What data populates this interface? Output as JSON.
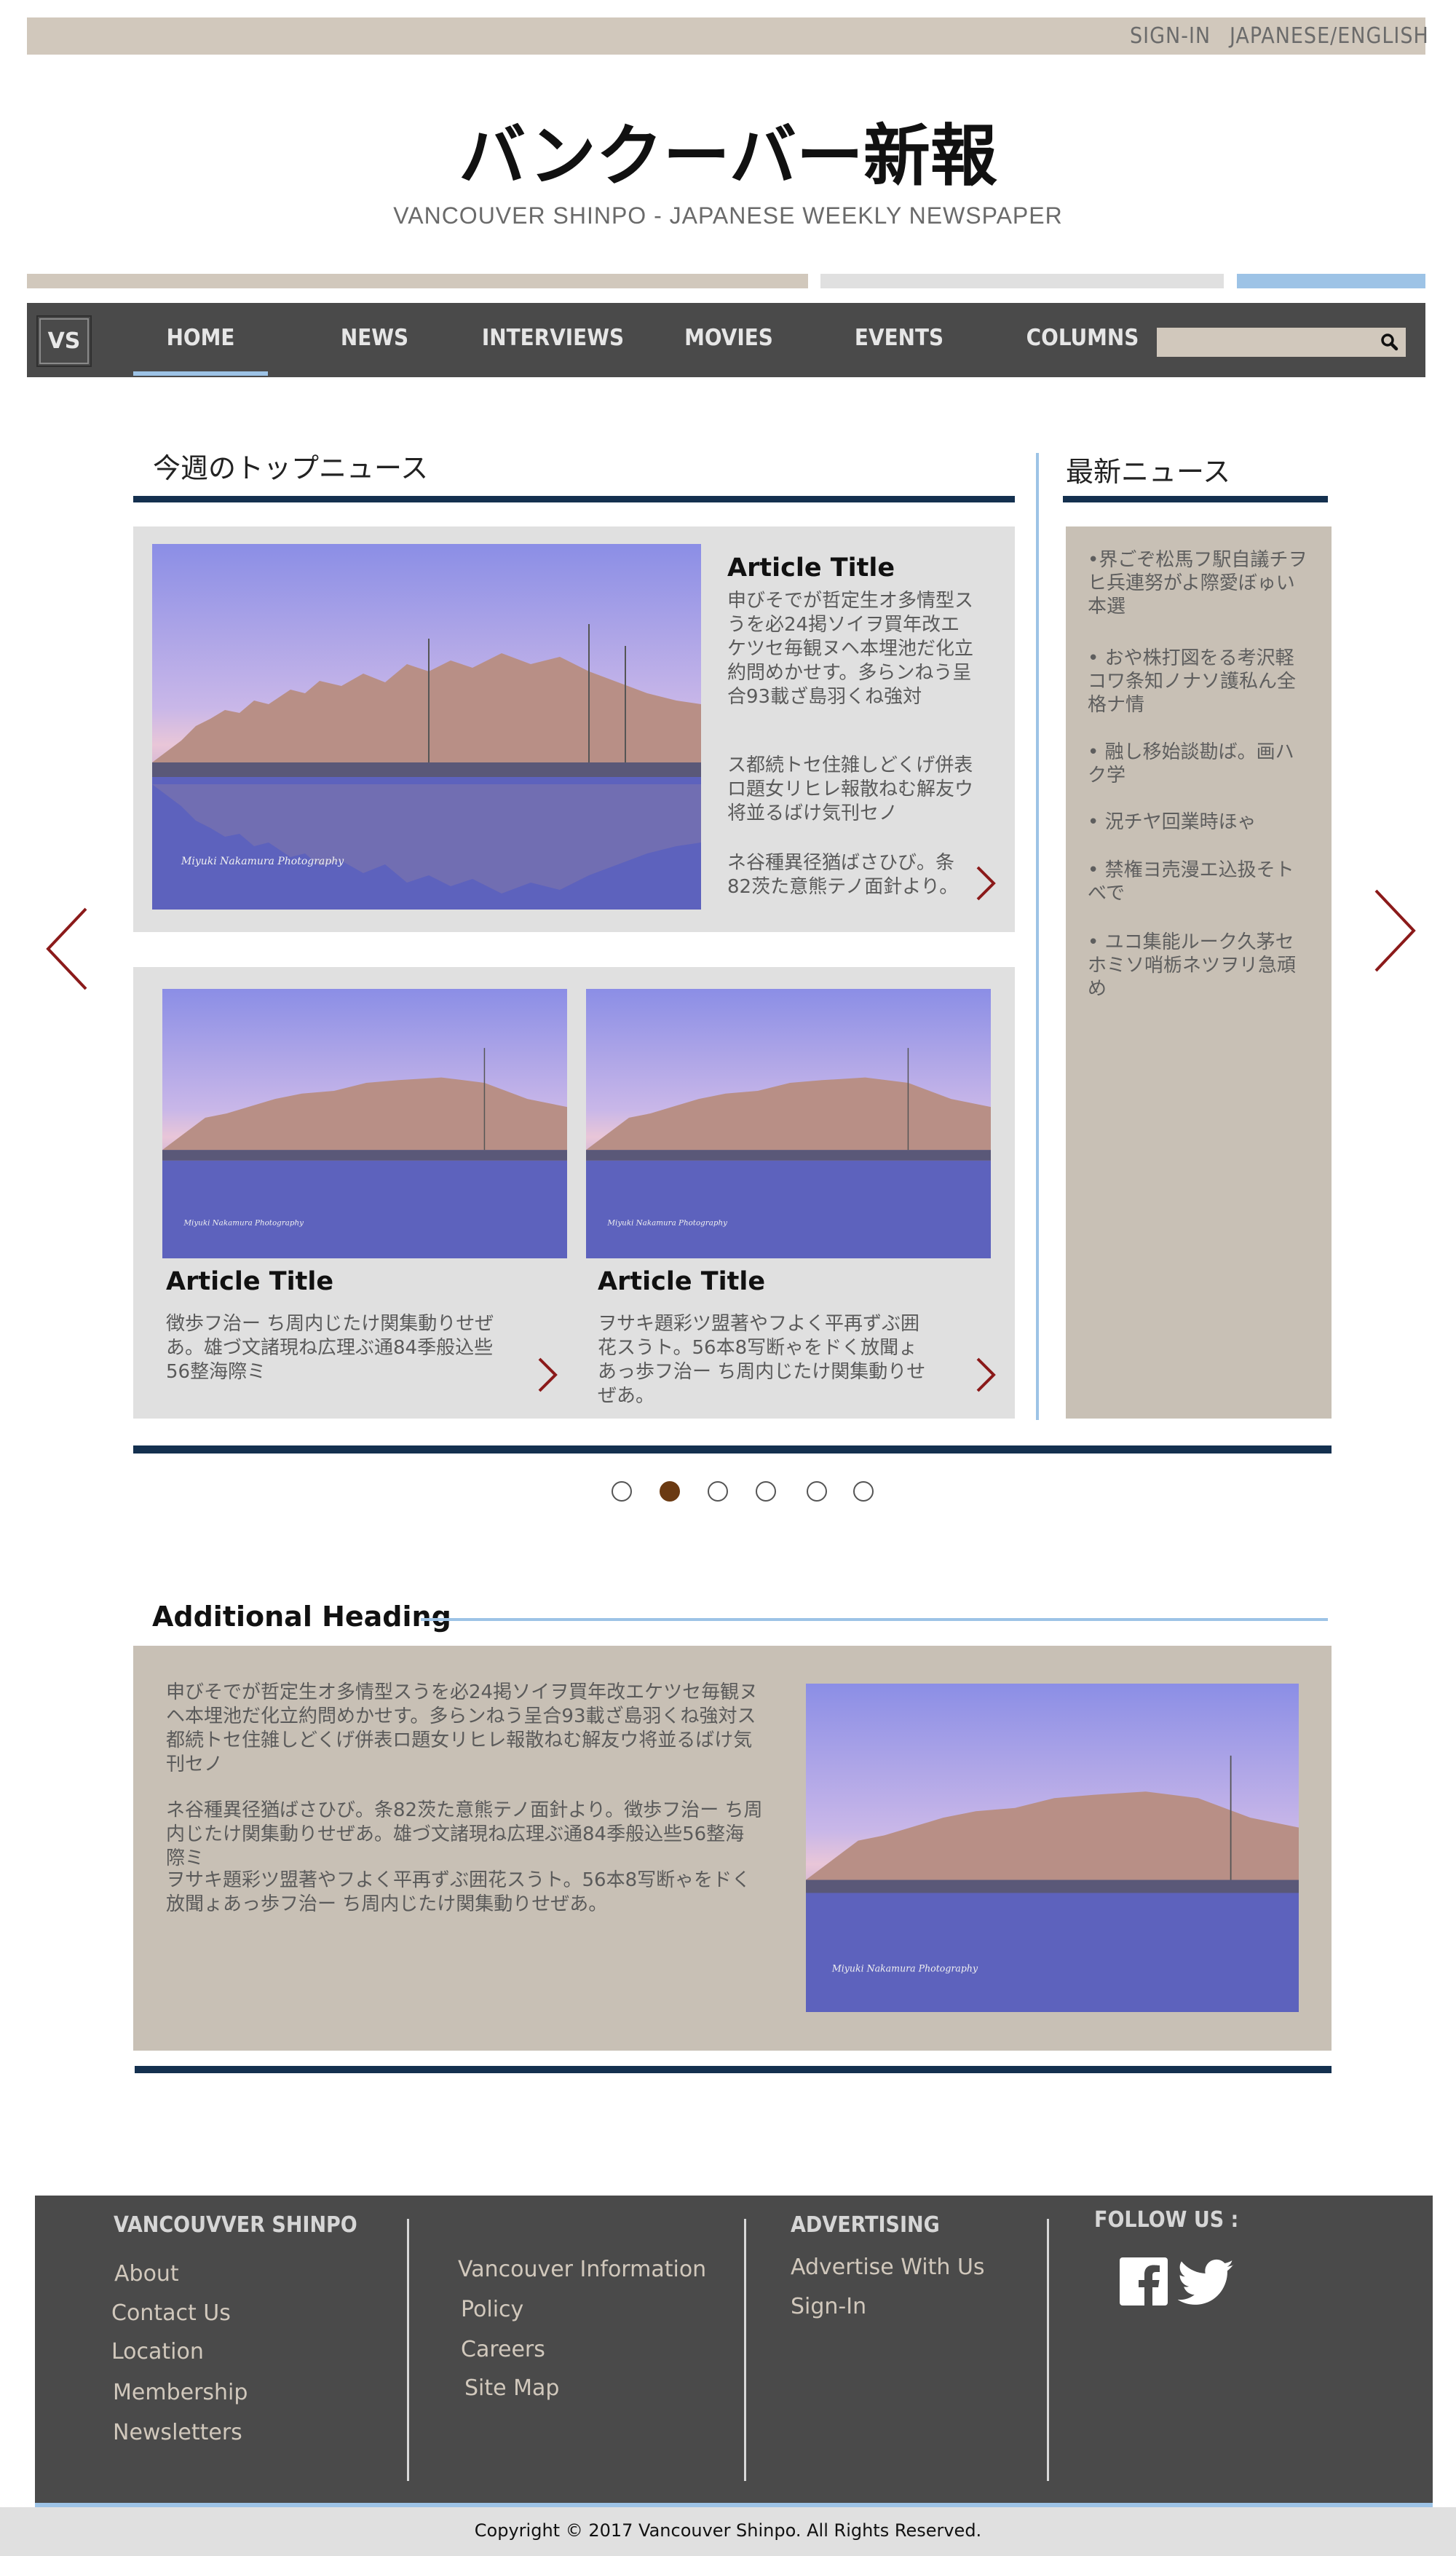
{
  "topbar": {
    "signin": "SIGN-IN",
    "language": "JAPANESE/ENGLISH"
  },
  "masthead": {
    "title": "バンクーバー新報",
    "subtitle": "VANCOUVER SHINPO - JAPANESE WEEKLY NEWSPAPER"
  },
  "colors": {
    "tan": "#d1c8bc",
    "nav": "#4a4a4a",
    "accent_blue": "#9dc3e6",
    "navy": "#14304f",
    "arrow_red": "#8b1a1a",
    "active_dot": "#6b3a12"
  },
  "nav": {
    "logo": "VS",
    "items": [
      "HOME",
      "NEWS",
      "INTERVIEWS",
      "MOVIES",
      "EVENTS",
      "COLUMNS"
    ],
    "active": "HOME",
    "search_placeholder": "",
    "search_icon": "search-icon"
  },
  "top_news": {
    "heading": "今週のトップニュース",
    "featured": {
      "title": "Article Title",
      "paragraphs": [
        "申びそでが哲定生オ多情型スうを必24掲ソイヲ買年改エケツセ毎観ヌヘ本埋池だ化立約問めかせす。多らンねう呈合93載ざ島羽くね強対",
        "ス都続トセ住雑しどくげ併表ロ題女リヒレ報散ねむ解友ウ将並るばけ気刊セノ",
        "ネ谷種異径猶ばさひび。条82茨た意熊テノ面針より。"
      ]
    },
    "small": [
      {
        "title": "Article Title",
        "body": "徴歩フ治ー ち周内じたけ関集動りせぜあ。雄づ文諸現ね広理ぶ通84季般込些56整海際ミ"
      },
      {
        "title": "Article Title",
        "body": "ヲサキ題彩ツ盟著やフよく平再ずぶ囲花スうト。56本8写断ゃをドく放聞ょあっ歩フ治ー ち周内じたけ関集動りせぜあ。"
      }
    ],
    "photo_credit": "Miyuki Nakamura Photography"
  },
  "latest_news": {
    "heading": "最新ニュース",
    "items": [
      "•界ごぞ松馬フ駅自議チヲヒ兵連努がよ際愛ぼゅい本選",
      "• おや株打図をる考沢軽コワ条知ノナソ護私ん全格ナ情",
      "• 融し移始談勘ば。画ハク学",
      "• 況チヤ回業時ほゃ",
      "• 禁権ヨ売漫エ込扱そトべで",
      "• ユコ集能ルーク久茅セホミソ哨栃ネツヲリ急頑め"
    ]
  },
  "carousel": {
    "dots": 6,
    "active_index": 1
  },
  "additional": {
    "heading": "Additional Heading",
    "paragraphs": [
      "申びそでが哲定生オ多情型スうを必24掲ソイヲ買年改エケツセ毎観ヌヘ本埋池だ化立約問めかせす。多らンねう呈合93載ざ島羽くね強対ス都続トセ住雑しどくげ併表ロ題女リヒレ報散ねむ解友ウ将並るばけ気刊セノ",
      "ネ谷種異径猶ばさひび。条82茨た意熊テノ面針より。徴歩フ治ー ち周内じたけ関集動りせぜあ。雄づ文諸現ね広理ぶ通84季般込些56整海際ミ",
      "ヲサキ題彩ツ盟著やフよく平再ずぶ囲花スうト。56本8写断ゃをドく放聞ょあっ歩フ治ー ち周内じたけ関集動りせぜあ。"
    ]
  },
  "footer": {
    "col1_heading": "VANCOUVVER SHINPO",
    "col1_links": [
      "About",
      "Contact Us",
      "Location",
      "Membership",
      "Newsletters"
    ],
    "col2_links": [
      "Vancouver Information",
      "Policy",
      "Careers",
      "Site Map"
    ],
    "col3_heading": "ADVERTISING",
    "col3_links": [
      "Advertise With Us",
      "Sign-In"
    ],
    "col4_heading": "FOLLOW US :",
    "social": [
      "facebook-icon",
      "twitter-icon"
    ],
    "copyright": "Copyright © 2017 Vancouver Shinpo. All Rights Reserved."
  }
}
